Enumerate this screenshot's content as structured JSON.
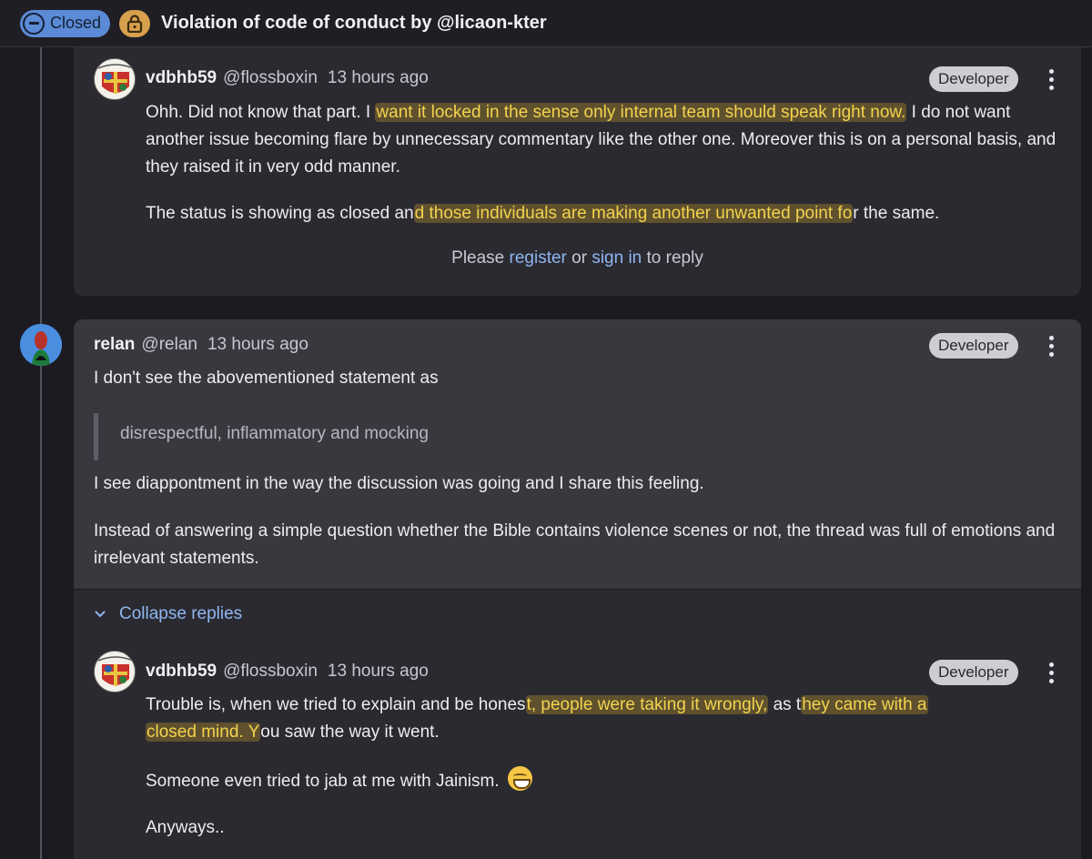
{
  "header": {
    "status": "Closed",
    "title": "Violation of code of conduct by @licaon-kter"
  },
  "comment_1": {
    "author": "vdbhb59",
    "handle": "@flossboxin",
    "time": "13 hours ago",
    "role": "Developer",
    "p1_a": "Ohh. Did not know that part. I ",
    "p1_hl": "want it locked in the sense only internal team should speak right now.",
    "p1_b": " I do not want another issue becoming flare by unnecessary commentary like the other one. Moreover this is on a personal basis, and they raised it in very odd manner.",
    "p2_a": "The status is showing as closed an",
    "p2_hl": "d those individuals are making another unwanted point fo",
    "p2_b": "r the same."
  },
  "reply_prompt": {
    "before": "Please ",
    "register": "register",
    "or": " or ",
    "sign_in": "sign in",
    "after": " to reply"
  },
  "comment_2": {
    "author": "relan",
    "handle": "@relan",
    "time": "13 hours ago",
    "role": "Developer",
    "p1": "I don't see the abovementioned statement as",
    "quote": "disrespectful, inflammatory and mocking",
    "p2": "I see diappontment in the way the discussion was going and I share this feeling.",
    "p3": "Instead of answering a simple question whether the Bible contains violence scenes or not, the thread was full of emotions and irrelevant statements."
  },
  "collapse_label": "Collapse replies",
  "comment_3": {
    "author": "vdbhb59",
    "handle": "@flossboxin",
    "time": "13 hours ago",
    "role": "Developer",
    "p1_a": "Trouble is, when we tried to explain and be hones",
    "p1_hl1": "t, people were taking it wrongly,",
    "p1_b": " as t",
    "p1_hl2": "hey came with a",
    "p1_hl3": "closed mind. Y",
    "p1_c": "ou saw the way it went.",
    "p2": "Someone even tried to jab at me with Jainism.",
    "p2_emoji": "grinning-face-emoji",
    "p3": "Anyways.."
  },
  "colors": {
    "background": "#1c1b22",
    "card": "#2b2a31",
    "card_highlight": "#39383f",
    "link": "#8fb6f0",
    "highlight_text": "#f3d34e",
    "status_closed": "#5b8bd6",
    "lock": "#d6a04c"
  }
}
